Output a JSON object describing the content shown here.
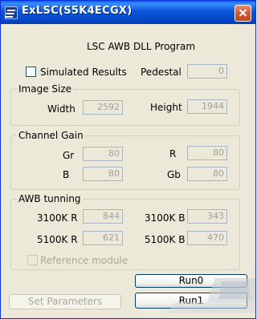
{
  "window": {
    "title": "ExLSC(S5K4ECGX)"
  },
  "heading": "LSC AWB DLL Program",
  "simulated_results": {
    "label": "Simulated Results",
    "checked": false
  },
  "pedestal": {
    "label": "Pedestal",
    "value": "0"
  },
  "image_size": {
    "legend": "Image Size",
    "width": {
      "label": "Width",
      "value": "2592"
    },
    "height": {
      "label": "Height",
      "value": "1944"
    }
  },
  "channel_gain": {
    "legend": "Channel Gain",
    "gr": {
      "label": "Gr",
      "value": "80"
    },
    "r": {
      "label": "R",
      "value": "80"
    },
    "b": {
      "label": "B",
      "value": "80"
    },
    "gb": {
      "label": "Gb",
      "value": "80"
    }
  },
  "awb_tuning": {
    "legend": "AWB tunning",
    "r3100": {
      "label": "3100K R",
      "value": "844"
    },
    "b3100": {
      "label": "3100K B",
      "value": "343"
    },
    "r5100": {
      "label": "5100K R",
      "value": "621"
    },
    "b5100": {
      "label": "5100K B",
      "value": "470"
    },
    "reference_module": {
      "label": "Reference module",
      "checked": false
    }
  },
  "buttons": {
    "set_parameters": "Set Parameters",
    "run0": "Run0",
    "run1": "Run1"
  }
}
